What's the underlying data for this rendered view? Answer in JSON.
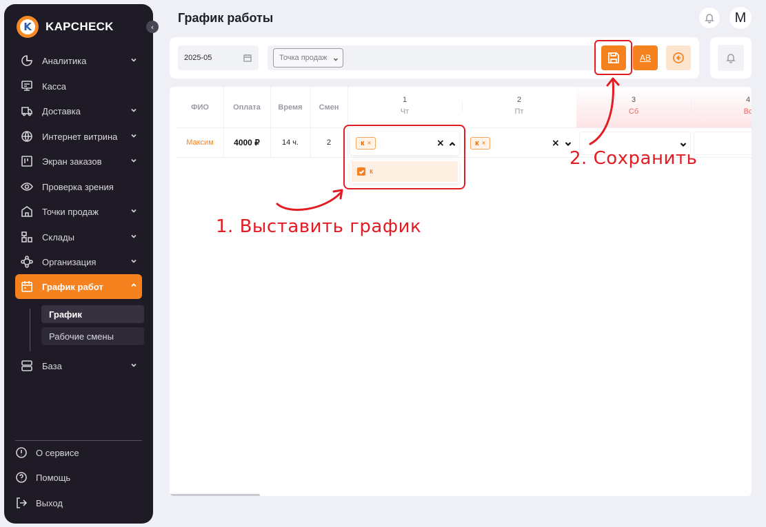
{
  "brand": {
    "name": "KAPCHECK",
    "logo_letter": "K"
  },
  "sidebar": {
    "items": [
      {
        "label": "Аналитика",
        "icon": "pie-chart-icon",
        "chevron": true
      },
      {
        "label": "Касса",
        "icon": "cash-register-icon",
        "chevron": false
      },
      {
        "label": "Доставка",
        "icon": "truck-icon",
        "chevron": true
      },
      {
        "label": "Интернет витрина",
        "icon": "globe-icon",
        "chevron": true
      },
      {
        "label": "Экран заказов",
        "icon": "board-icon",
        "chevron": true
      },
      {
        "label": "Проверка зрения",
        "icon": "eye-icon",
        "chevron": false
      },
      {
        "label": "Точки продаж",
        "icon": "store-icon",
        "chevron": true
      },
      {
        "label": "Склады",
        "icon": "warehouse-icon",
        "chevron": true
      },
      {
        "label": "Организация",
        "icon": "organization-icon",
        "chevron": true
      },
      {
        "label": "График работ",
        "icon": "calendar-icon",
        "chevron": true,
        "active": true
      },
      {
        "label": "База",
        "icon": "database-icon",
        "chevron": true
      }
    ],
    "subitems": [
      {
        "label": "График",
        "selected": true
      },
      {
        "label": "Рабочие смены",
        "selected": false
      }
    ],
    "footer": [
      {
        "label": "О сервисе",
        "icon": "info-icon"
      },
      {
        "label": "Помощь",
        "icon": "help-icon"
      },
      {
        "label": "Выход",
        "icon": "logout-icon"
      }
    ]
  },
  "header": {
    "title": "График работы",
    "avatar_letter": "M"
  },
  "toolbar": {
    "date_value": "2025-05",
    "store_placeholder": "Точка продаж",
    "ab_label": "AB"
  },
  "table": {
    "columns": {
      "name": "ФИО",
      "pay": "Оплата",
      "time": "Время",
      "shifts": "Смен"
    },
    "days": [
      {
        "num": "1",
        "weekday": "Чт",
        "weekend": false
      },
      {
        "num": "2",
        "weekday": "Пт",
        "weekend": false
      },
      {
        "num": "3",
        "weekday": "Сб",
        "weekend": true
      },
      {
        "num": "4",
        "weekday": "Вс",
        "weekend": true
      }
    ],
    "rows": [
      {
        "name": "Максим",
        "pay": "4000 ₽",
        "time": "14 ч.",
        "shifts": "2",
        "day_tags": [
          "к",
          "к",
          "",
          ""
        ]
      }
    ],
    "dropdown_option": "к"
  },
  "annotations": {
    "step1": "1. Выставить график",
    "step2": "2. Сохранить"
  },
  "colors": {
    "accent": "#f5821f",
    "sidebar_bg": "#1f1b26",
    "annotation": "#e31c23"
  }
}
